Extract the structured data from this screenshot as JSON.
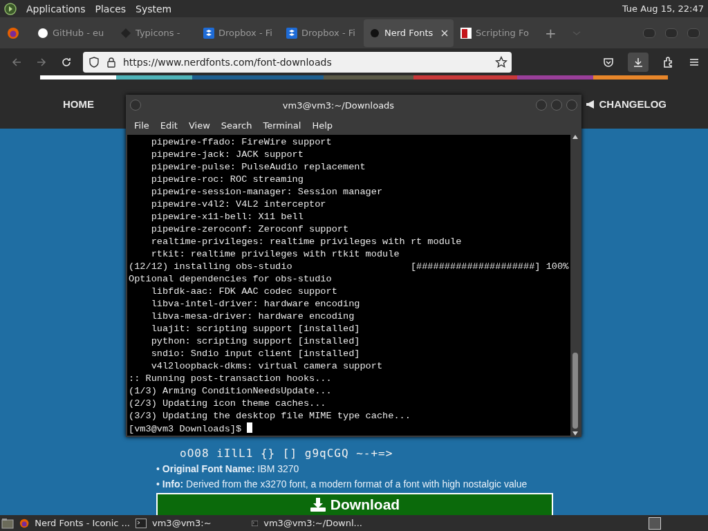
{
  "top_panel": {
    "menus": [
      "Applications",
      "Places",
      "System"
    ],
    "clock": "Tue Aug 15, 22:47"
  },
  "browser": {
    "tabs": [
      {
        "label": "GitHub - eu",
        "kind": "github",
        "selected": false
      },
      {
        "label": "Typicons - ",
        "kind": "diamond",
        "selected": false
      },
      {
        "label": "Dropbox - Fi",
        "kind": "dropbox",
        "selected": false
      },
      {
        "label": "Dropbox - Fi",
        "kind": "dropbox",
        "selected": false
      },
      {
        "label": "Nerd Fonts",
        "kind": "nerd",
        "selected": true
      },
      {
        "label": "Scripting Fo",
        "kind": "script",
        "selected": false
      }
    ],
    "new_tab": "+",
    "url": "https://www.nerdfonts.com/font-downloads"
  },
  "page": {
    "nav": [
      "HOME",
      "CHANGELOG"
    ],
    "glyph_lines": [
      "oO08 iIlL1 {} [] g9qCGQ ~-+=>"
    ],
    "info": [
      "• **Original Font Name:** IBM 3270",
      "• **Info:** Derived from the x3270 font, a modern format of a font with high nostalgic value"
    ],
    "download_button": "Download"
  },
  "terminal": {
    "title": "vm3@vm3:~/Downloads",
    "menus": [
      "File",
      "Edit",
      "View",
      "Search",
      "Terminal",
      "Help"
    ],
    "lines": [
      "    pipewire-ffado: FireWire support",
      "    pipewire-jack: JACK support",
      "    pipewire-pulse: PulseAudio replacement",
      "    pipewire-roc: ROC streaming",
      "    pipewire-session-manager: Session manager",
      "    pipewire-v4l2: V4L2 interceptor",
      "    pipewire-x11-bell: X11 bell",
      "    pipewire-zeroconf: Zeroconf support",
      "    realtime-privileges: realtime privileges with rt module",
      "    rtkit: realtime privileges with rtkit module",
      "(12/12) installing obs-studio                     [#####################] 100%",
      "Optional dependencies for obs-studio",
      "    libfdk-aac: FDK AAC codec support",
      "    libva-intel-driver: hardware encoding",
      "    libva-mesa-driver: hardware encoding",
      "    luajit: scripting support [installed]",
      "    python: scripting support [installed]",
      "    sndio: Sndio input client [installed]",
      "    v4l2loopback-dkms: virtual camera support",
      ":: Running post-transaction hooks...",
      "(1/3) Arming ConditionNeedsUpdate...",
      "(2/3) Updating icon theme caches...",
      "(3/3) Updating the desktop file MIME type cache...",
      "[vm3@vm3 Downloads]$ "
    ]
  },
  "taskbar": {
    "items": [
      {
        "label": "Nerd Fonts - Iconic ...",
        "kind": "firefox"
      },
      {
        "label": "vm3@vm3:~",
        "kind": "terminal"
      },
      {
        "label": "vm3@vm3:~/Downl...",
        "kind": "terminal"
      }
    ]
  }
}
